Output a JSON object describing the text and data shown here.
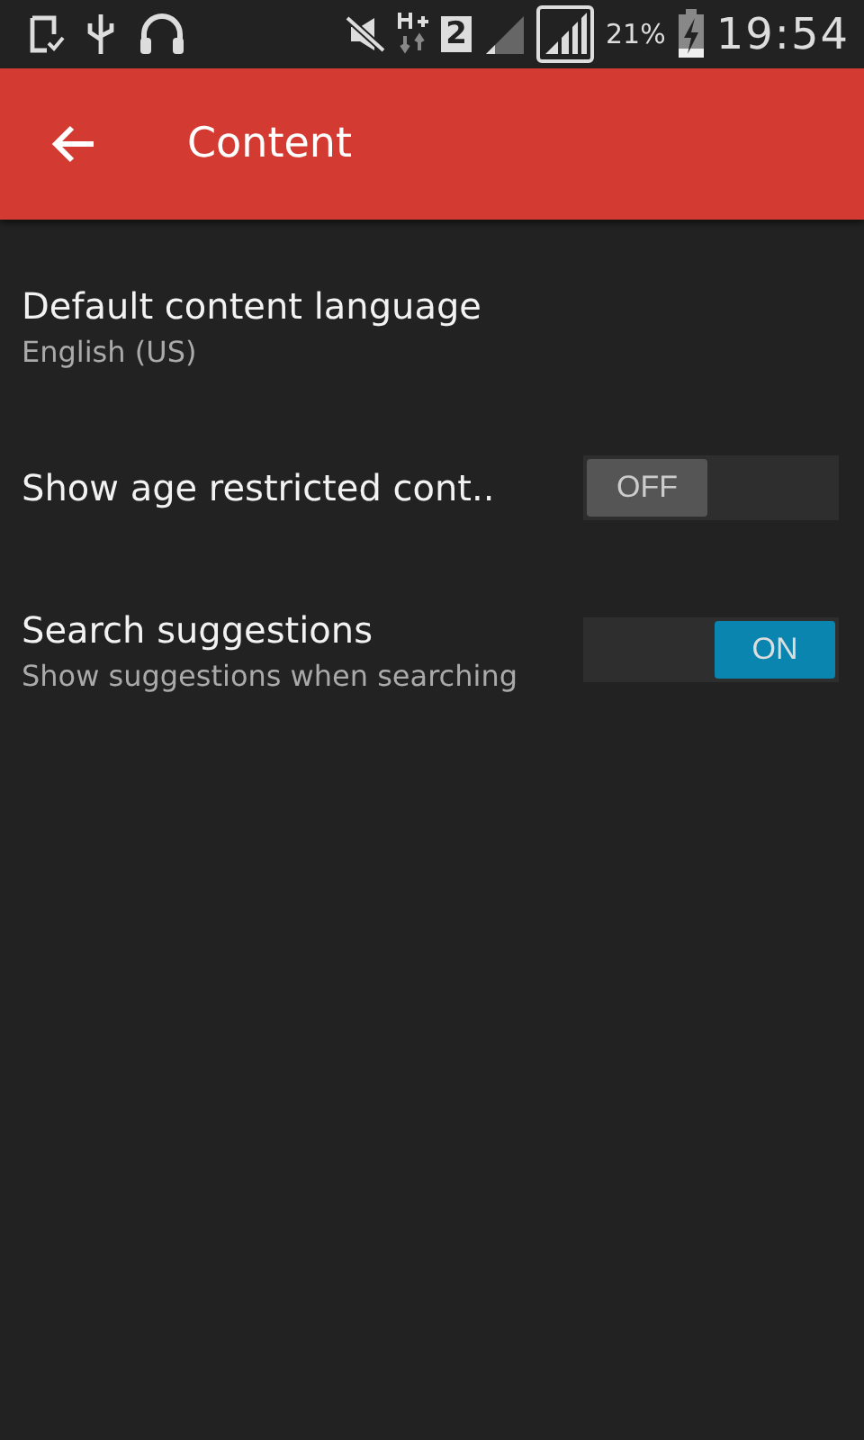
{
  "status_bar": {
    "sim_slot": "2",
    "battery": "21%",
    "time": "19:54"
  },
  "app_bar": {
    "title": "Content"
  },
  "settings": [
    {
      "kind": "plain",
      "title": "Default content language",
      "summary": "English (US)"
    },
    {
      "kind": "toggle",
      "title": "Show age restricted cont..",
      "on": false,
      "toggle_label": "OFF"
    },
    {
      "kind": "toggle",
      "title": "Search suggestions",
      "summary": "Show suggestions when searching",
      "on": true,
      "toggle_label": "ON"
    }
  ]
}
